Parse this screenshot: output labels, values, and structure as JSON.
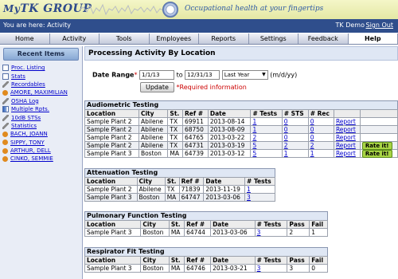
{
  "header": {
    "logo_my": "My",
    "logo_tk": "TK",
    "logo_rest": " GROUP",
    "tagline": "Occupational health at your fingertips"
  },
  "statusbar": {
    "location": "You are here: Activity",
    "user": "TK Demo",
    "signout": "Sign Out"
  },
  "nav": {
    "tabs": [
      "Home",
      "Activity",
      "Tools",
      "Employees",
      "Reports",
      "Settings",
      "Feedback",
      "Help"
    ],
    "active": "Help"
  },
  "sidebar": {
    "title": "Recent Items",
    "items": [
      {
        "label": "Proc. Listing",
        "icon": "document-icon"
      },
      {
        "label": "Stats",
        "icon": "document-icon"
      },
      {
        "label": "Recordables",
        "icon": "pencil-icon"
      },
      {
        "label": "AMORE, MAXIMILIAN",
        "icon": "person-icon"
      },
      {
        "label": "OSHA Log",
        "icon": "pencil-icon"
      },
      {
        "label": "Multiple Rpts.",
        "icon": "chart-icon"
      },
      {
        "label": "10dB STSs",
        "icon": "pencil-icon"
      },
      {
        "label": "Statistics",
        "icon": "pencil-icon"
      },
      {
        "label": "BACH, JOANN",
        "icon": "person-icon"
      },
      {
        "label": "SIPPY, TONY",
        "icon": "person-icon"
      },
      {
        "label": "ARTHUR, DELL",
        "icon": "person-icon"
      },
      {
        "label": "CINKO, SEMMIE",
        "icon": "person-icon"
      }
    ]
  },
  "main": {
    "title": "Processing Activity By Location",
    "filter": {
      "label": "Date Range",
      "required_mark": "*",
      "from": "1/1/13",
      "to_label": "to",
      "to": "12/31/13",
      "preset": "Last Year",
      "format_hint": "(m/d/yy)",
      "update_button": "Update",
      "required_note": "*Required information"
    },
    "audiometric": {
      "title": "Audiometric Testing",
      "headers": [
        "Location",
        "City",
        "St.",
        "Ref #",
        "Date",
        "# Tests",
        "# STS",
        "# Rec",
        "",
        ""
      ],
      "rows": [
        {
          "location": "Sample Plant 2",
          "city": "Abilene",
          "st": "TX",
          "ref": "69911",
          "date": "2013-08-14",
          "tests": "1",
          "sts": "0",
          "rec": "0",
          "report": "Report",
          "rate": ""
        },
        {
          "location": "Sample Plant 2",
          "city": "Abilene",
          "st": "TX",
          "ref": "68750",
          "date": "2013-08-09",
          "tests": "1",
          "sts": "0",
          "rec": "0",
          "report": "Report",
          "rate": ""
        },
        {
          "location": "Sample Plant 2",
          "city": "Abilene",
          "st": "TX",
          "ref": "64765",
          "date": "2013-03-22",
          "tests": "2",
          "sts": "0",
          "rec": "0",
          "report": "Report",
          "rate": ""
        },
        {
          "location": "Sample Plant 2",
          "city": "Abilene",
          "st": "TX",
          "ref": "64731",
          "date": "2013-03-19",
          "tests": "5",
          "sts": "2",
          "rec": "2",
          "report": "Report",
          "rate": "Rate it!"
        },
        {
          "location": "Sample Plant 3",
          "city": "Boston",
          "st": "MA",
          "ref": "64739",
          "date": "2013-03-12",
          "tests": "5",
          "sts": "1",
          "rec": "1",
          "report": "Report",
          "rate": "Rate it!"
        }
      ]
    },
    "attenuation": {
      "title": "Attenuation Testing",
      "headers": [
        "Location",
        "City",
        "St.",
        "Ref #",
        "Date",
        "# Tests"
      ],
      "rows": [
        {
          "location": "Sample Plant 2",
          "city": "Abilene",
          "st": "TX",
          "ref": "71839",
          "date": "2013-11-19",
          "tests": "1"
        },
        {
          "location": "Sample Plant 3",
          "city": "Boston",
          "st": "MA",
          "ref": "64747",
          "date": "2013-03-06",
          "tests": "3"
        }
      ]
    },
    "pulmonary": {
      "title": "Pulmonary Function Testing",
      "headers": [
        "Location",
        "City",
        "St.",
        "Ref #",
        "Date",
        "# Tests",
        "Pass",
        "Fail"
      ],
      "rows": [
        {
          "location": "Sample Plant 3",
          "city": "Boston",
          "st": "MA",
          "ref": "64744",
          "date": "2013-03-06",
          "tests": "3",
          "pass": "2",
          "fail": "1"
        }
      ]
    },
    "respirator": {
      "title": "Respirator Fit Testing",
      "headers": [
        "Location",
        "City",
        "St.",
        "Ref #",
        "Date",
        "# Tests",
        "Pass",
        "Fail"
      ],
      "rows": [
        {
          "location": "Sample Plant 3",
          "city": "Boston",
          "st": "MA",
          "ref": "64746",
          "date": "2013-03-21",
          "tests": "3",
          "pass": "3",
          "fail": "0"
        }
      ]
    }
  }
}
